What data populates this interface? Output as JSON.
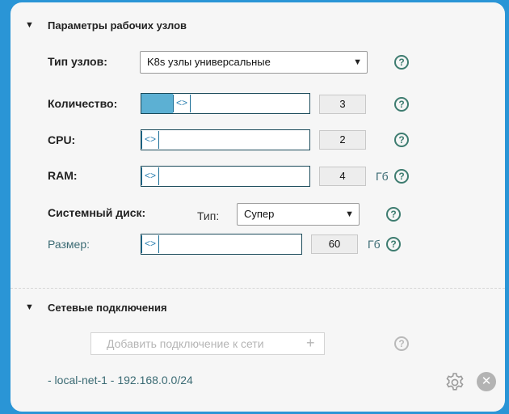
{
  "worker_params": {
    "title": "Параметры рабочих узлов",
    "node_type": {
      "label": "Тип узлов:",
      "value": "K8s узлы универсальные"
    },
    "count": {
      "label": "Количество:",
      "value": "3",
      "fill_fraction": 0.21
    },
    "cpu": {
      "label": "CPU:",
      "value": "2",
      "fill_fraction": 0.0
    },
    "ram": {
      "label": "RAM:",
      "value": "4",
      "unit": "Гб",
      "fill_fraction": 0.0
    },
    "system_disk": {
      "label": "Системный диск:",
      "type_label": "Тип:",
      "type_value": "Супер",
      "size_label": "Размер:",
      "size_value": "60",
      "size_unit": "Гб",
      "fill_fraction": 0.0
    },
    "help_glyph": "?"
  },
  "network": {
    "title": "Сетевые подключения",
    "add_button_label": "Добавить подключение к сети",
    "add_button_plus": "+",
    "items": [
      {
        "label": "- local-net-1 - 192.168.0.0/24"
      }
    ],
    "help_glyph": "?",
    "close_glyph": "✕"
  },
  "colors": {
    "background": "#2a95d6",
    "slider_fill": "#5cb0d3",
    "help_icon": "#3e7c70",
    "text_teal": "#3a6a73"
  },
  "icons": {
    "collapse": "triangle-down-icon",
    "help": "question-circle-icon",
    "slider_handle": "chevrons-left-right-icon",
    "gear": "gear-icon",
    "close": "close-circle-icon"
  }
}
